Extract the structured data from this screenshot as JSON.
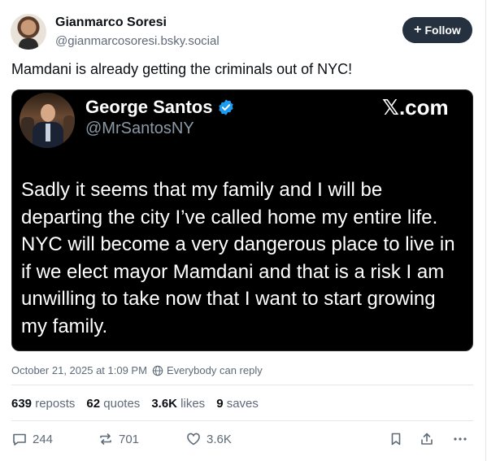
{
  "author": {
    "name": "Gianmarco Soresi",
    "handle": "@gianmarcosoresi.bsky.social"
  },
  "follow_button": {
    "label": "Follow"
  },
  "post_text": "Mamdani is already getting the criminals out of NYC!",
  "embed": {
    "name": "George Santos",
    "handle": "@MrSantosNY",
    "brand": "𝕏.com",
    "body": "Sadly it seems that my family and I will be departing the city I’ve called home my entire life. NYC will become a very dangerous place to live in if we elect mayor Mamdani and that is a risk I am unwilling to take now that I want to start growing my family."
  },
  "meta": {
    "timestamp": "October 21, 2025 at 1:09 PM",
    "reply_setting": "Everybody can reply"
  },
  "stats": {
    "reposts_count": "639",
    "reposts_label": "reposts",
    "quotes_count": "62",
    "quotes_label": "quotes",
    "likes_count": "3.6K",
    "likes_label": "likes",
    "saves_count": "9",
    "saves_label": "saves"
  },
  "actions": {
    "reply_count": "244",
    "repost_count": "701",
    "like_count": "3.6K"
  },
  "colors": {
    "follow_bg": "#263140",
    "embed_bg": "#000000",
    "muted_text": "#5e6a78",
    "verified": "#1d9bf0"
  }
}
